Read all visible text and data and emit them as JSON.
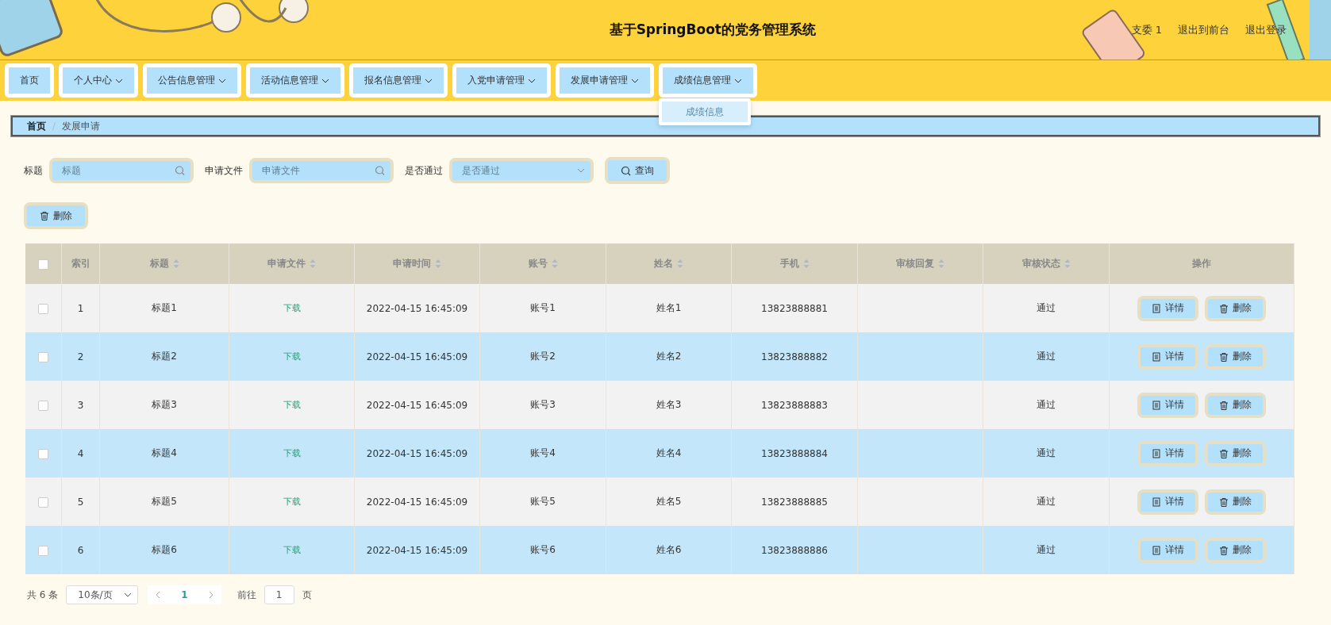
{
  "header": {
    "title": "基于SpringBoot的党务管理系统",
    "links": [
      "支委 1",
      "退出到前台",
      "退出登录"
    ]
  },
  "nav": {
    "items": [
      {
        "label": "首页",
        "has_menu": false
      },
      {
        "label": "个人中心",
        "has_menu": true
      },
      {
        "label": "公告信息管理",
        "has_menu": true
      },
      {
        "label": "活动信息管理",
        "has_menu": true
      },
      {
        "label": "报名信息管理",
        "has_menu": true
      },
      {
        "label": "入党申请管理",
        "has_menu": true
      },
      {
        "label": "发展申请管理",
        "has_menu": true
      },
      {
        "label": "成绩信息管理",
        "has_menu": true,
        "expanded": true,
        "menu": [
          "成绩信息"
        ]
      }
    ]
  },
  "breadcrumb": {
    "items": [
      "首页",
      "发展申请"
    ],
    "separator": "/"
  },
  "search": {
    "fields": [
      {
        "label": "标题",
        "placeholder": "标题",
        "kind": "text"
      },
      {
        "label": "申请文件",
        "placeholder": "申请文件",
        "kind": "text"
      },
      {
        "label": "是否通过",
        "placeholder": "是否通过",
        "kind": "select"
      }
    ],
    "button": "查询"
  },
  "delete_button": "删除",
  "table": {
    "columns": [
      {
        "label": "索引",
        "sortable": false
      },
      {
        "label": "标题",
        "sortable": true
      },
      {
        "label": "申请文件",
        "sortable": true
      },
      {
        "label": "申请时间",
        "sortable": true
      },
      {
        "label": "账号",
        "sortable": true
      },
      {
        "label": "姓名",
        "sortable": true
      },
      {
        "label": "手机",
        "sortable": true
      },
      {
        "label": "审核回复",
        "sortable": true
      },
      {
        "label": "审核状态",
        "sortable": true
      },
      {
        "label": "操作",
        "sortable": false
      }
    ],
    "select_all_checked": false,
    "rows": [
      {
        "checked": false,
        "cells": [
          "1",
          "标题1",
          "下载",
          "2022-04-15 16:45:09",
          "账号1",
          "姓名1",
          "13823888881",
          "",
          "通过"
        ],
        "actions": [
          "详情",
          "删除"
        ]
      },
      {
        "checked": false,
        "cells": [
          "2",
          "标题2",
          "下载",
          "2022-04-15 16:45:09",
          "账号2",
          "姓名2",
          "13823888882",
          "",
          "通过"
        ],
        "actions": [
          "详情",
          "删除"
        ]
      },
      {
        "checked": false,
        "cells": [
          "3",
          "标题3",
          "下载",
          "2022-04-15 16:45:09",
          "账号3",
          "姓名3",
          "13823888883",
          "",
          "通过"
        ],
        "actions": [
          "详情",
          "删除"
        ]
      },
      {
        "checked": false,
        "cells": [
          "4",
          "标题4",
          "下载",
          "2022-04-15 16:45:09",
          "账号4",
          "姓名4",
          "13823888884",
          "",
          "通过"
        ],
        "actions": [
          "详情",
          "删除"
        ]
      },
      {
        "checked": false,
        "cells": [
          "5",
          "标题5",
          "下载",
          "2022-04-15 16:45:09",
          "账号5",
          "姓名5",
          "13823888885",
          "",
          "通过"
        ],
        "actions": [
          "详情",
          "删除"
        ]
      },
      {
        "checked": false,
        "cells": [
          "6",
          "标题6",
          "下载",
          "2022-04-15 16:45:09",
          "账号6",
          "姓名6",
          "13823888886",
          "",
          "通过"
        ],
        "actions": [
          "详情",
          "删除"
        ]
      }
    ]
  },
  "pagination": {
    "total": "共 6 条",
    "page_size": "10条/页",
    "pages": [
      {
        "label": "1",
        "selected": true
      }
    ],
    "goto_label": "前往",
    "goto_value": "1",
    "goto_suffix": "页"
  }
}
